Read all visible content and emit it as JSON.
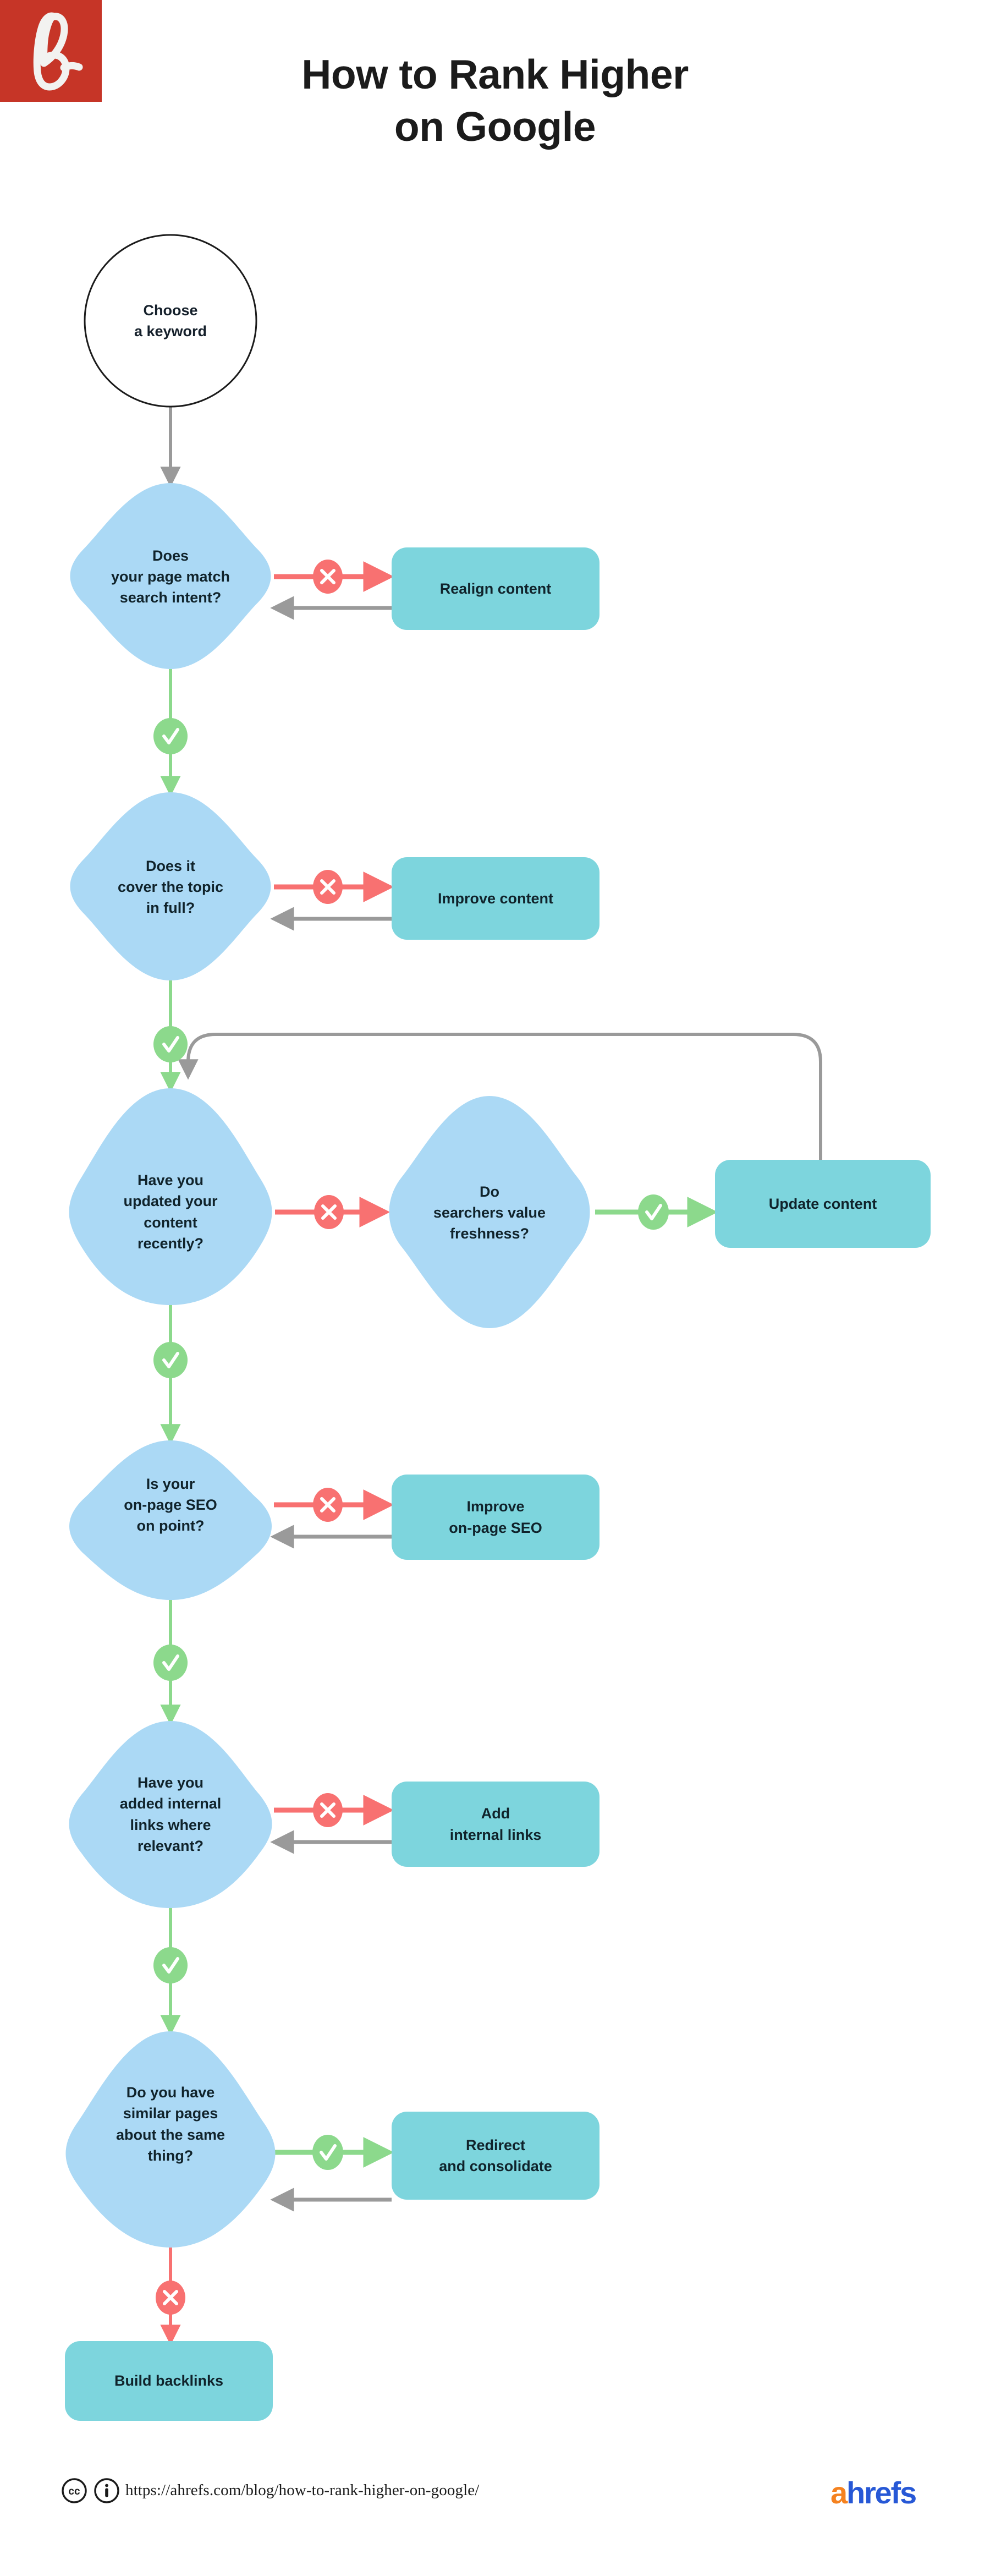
{
  "brand": {
    "logo_mark_color": "#C63527",
    "logo_glyph": "b",
    "wordmark_prefix": "a",
    "wordmark_suffix": "hrefs",
    "wordmark_prefix_color": "#F58220",
    "wordmark_suffix_color": "#2758D6"
  },
  "header": {
    "title_line1": "How to Rank Higher",
    "title_line2": "on Google"
  },
  "palette": {
    "decision_fill": "#ABD9F5",
    "action_fill": "#7DD5DD",
    "yes_green": "#8CD98C",
    "no_red": "#F87171",
    "neutral_gray": "#9A9A9A",
    "text_dark": "#10232B",
    "page_background": "#FFFFFF"
  },
  "flowchart": {
    "type": "decision-flowchart",
    "start": {
      "id": "start",
      "shape": "circle",
      "line1": "Choose",
      "line2": "a keyword"
    },
    "nodes": [
      {
        "id": "d1",
        "shape": "decision",
        "lines": [
          "Does",
          "your page match",
          "search intent?"
        ]
      },
      {
        "id": "a1",
        "shape": "action",
        "lines": [
          "Realign content"
        ]
      },
      {
        "id": "d2",
        "shape": "decision",
        "lines": [
          "Does it",
          "cover the topic",
          "in full?"
        ]
      },
      {
        "id": "a2",
        "shape": "action",
        "lines": [
          "Improve content"
        ]
      },
      {
        "id": "d3",
        "shape": "decision",
        "lines": [
          "Have you",
          "updated your",
          "content",
          "recently?"
        ]
      },
      {
        "id": "d3b",
        "shape": "decision",
        "lines": [
          "Do",
          "searchers value",
          "freshness?"
        ]
      },
      {
        "id": "a3",
        "shape": "action",
        "lines": [
          "Update content"
        ]
      },
      {
        "id": "d4",
        "shape": "decision",
        "lines": [
          "Is your",
          "on-page SEO",
          "on point?"
        ]
      },
      {
        "id": "a4",
        "shape": "action",
        "lines": [
          "Improve",
          "on-page SEO"
        ]
      },
      {
        "id": "d5",
        "shape": "decision",
        "lines": [
          "Have you",
          "added internal",
          "links where",
          "relevant?"
        ]
      },
      {
        "id": "a5",
        "shape": "action",
        "lines": [
          "Add",
          "internal links"
        ]
      },
      {
        "id": "d6",
        "shape": "decision",
        "lines": [
          "Do you have",
          "similar pages",
          "about the same",
          "thing?"
        ]
      },
      {
        "id": "a6",
        "shape": "action",
        "lines": [
          "Redirect",
          "and consolidate"
        ]
      },
      {
        "id": "end",
        "shape": "action",
        "lines": [
          "Build backlinks"
        ]
      }
    ],
    "edges": [
      {
        "from": "start",
        "to": "d1",
        "badge": "none",
        "color": "#9A9A9A"
      },
      {
        "from": "d1",
        "to": "a1",
        "badge": "cross",
        "color": "#F87171"
      },
      {
        "from": "a1",
        "to": "d1",
        "badge": "none",
        "color": "#9A9A9A"
      },
      {
        "from": "d1",
        "to": "d2",
        "badge": "check",
        "color": "#8CD98C"
      },
      {
        "from": "d2",
        "to": "a2",
        "badge": "cross",
        "color": "#F87171"
      },
      {
        "from": "a2",
        "to": "d2",
        "badge": "none",
        "color": "#9A9A9A"
      },
      {
        "from": "d2",
        "to": "d3",
        "badge": "check",
        "color": "#8CD98C"
      },
      {
        "from": "d3",
        "to": "d3b",
        "badge": "cross",
        "color": "#F87171"
      },
      {
        "from": "d3b",
        "to": "a3",
        "badge": "check",
        "color": "#8CD98C"
      },
      {
        "from": "a3",
        "to": "d3",
        "badge": "none",
        "color": "#9A9A9A"
      },
      {
        "from": "d3",
        "to": "d4",
        "badge": "check",
        "color": "#8CD98C"
      },
      {
        "from": "d4",
        "to": "a4",
        "badge": "cross",
        "color": "#F87171"
      },
      {
        "from": "a4",
        "to": "d4",
        "badge": "none",
        "color": "#9A9A9A"
      },
      {
        "from": "d4",
        "to": "d5",
        "badge": "check",
        "color": "#8CD98C"
      },
      {
        "from": "d5",
        "to": "a5",
        "badge": "cross",
        "color": "#F87171"
      },
      {
        "from": "a5",
        "to": "d5",
        "badge": "none",
        "color": "#9A9A9A"
      },
      {
        "from": "d5",
        "to": "d6",
        "badge": "check",
        "color": "#8CD98C"
      },
      {
        "from": "d6",
        "to": "a6",
        "badge": "check",
        "color": "#8CD98C"
      },
      {
        "from": "a6",
        "to": "d6",
        "badge": "none",
        "color": "#9A9A9A"
      },
      {
        "from": "d6",
        "to": "end",
        "badge": "cross",
        "color": "#F87171"
      }
    ],
    "badge_glyphs": {
      "check": "✓",
      "cross": "✕"
    }
  },
  "node_text": {
    "start_l1": "Choose",
    "start_l2": "a keyword",
    "d1_l1": "Does",
    "d1_l2": "your page match",
    "d1_l3": "search intent?",
    "a1": "Realign content",
    "d2_l1": "Does it",
    "d2_l2": "cover the topic",
    "d2_l3": "in full?",
    "a2": "Improve content",
    "d3_l1": "Have you",
    "d3_l2": "updated your",
    "d3_l3": "content",
    "d3_l4": "recently?",
    "d3b_l1": "Do",
    "d3b_l2": "searchers value",
    "d3b_l3": "freshness?",
    "a3": "Update content",
    "d4_l1": "Is your",
    "d4_l2": "on-page SEO",
    "d4_l3": "on point?",
    "a4_l1": "Improve",
    "a4_l2": "on-page SEO",
    "d5_l1": "Have you",
    "d5_l2": "added internal",
    "d5_l3": "links where",
    "d5_l4": "relevant?",
    "a5_l1": "Add",
    "a5_l2": "internal links",
    "d6_l1": "Do you have",
    "d6_l2": "similar pages",
    "d6_l3": "about the same",
    "d6_l4": "thing?",
    "a6_l1": "Redirect",
    "a6_l2": "and consolidate",
    "end": "Build backlinks"
  },
  "footer": {
    "license_icon_1": "creative-commons-icon",
    "license_icon_2": "attribution-icon",
    "url": "https://ahrefs.com/blog/how-to-rank-higher-on-google/"
  }
}
